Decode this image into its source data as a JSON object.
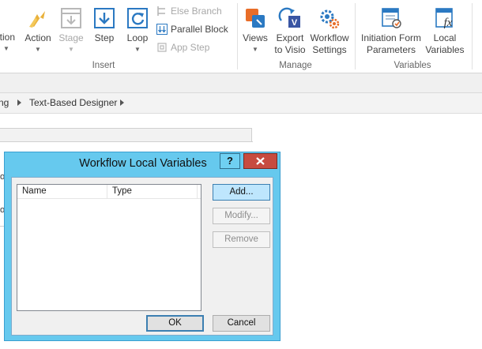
{
  "ribbon": {
    "insert_group": {
      "label": "Insert",
      "condition": "ition",
      "action": "Action",
      "stage": "Stage",
      "step": "Step",
      "loop": "Loop",
      "else_branch": "Else Branch",
      "parallel_block": "Parallel Block",
      "app_step": "App Step"
    },
    "manage_group": {
      "label": "Manage",
      "views": "Views",
      "export_line1": "Export",
      "export_line2": "to Visio",
      "settings_line1": "Workflow",
      "settings_line2": "Settings"
    },
    "variables_group": {
      "label": "Variables",
      "initiation_line1": "Initiation Form",
      "initiation_line2": "Parameters",
      "local_line1": "Local",
      "local_line2": "Variables"
    }
  },
  "breadcrumb": {
    "items": [
      "ng",
      "Text-Based Designer"
    ]
  },
  "designer": {
    "edge_letter_1": "o",
    "edge_letter_2": "o"
  },
  "dialog": {
    "title": "Workflow Local Variables",
    "help": "?",
    "columns": [
      "Name",
      "Type"
    ],
    "add": "Add...",
    "modify": "Modify...",
    "remove": "Remove",
    "ok": "OK",
    "cancel": "Cancel"
  },
  "colors": {
    "dialog_frame": "#66c9ee",
    "close_button": "#c74b3f",
    "accent": "#2b79c2"
  }
}
